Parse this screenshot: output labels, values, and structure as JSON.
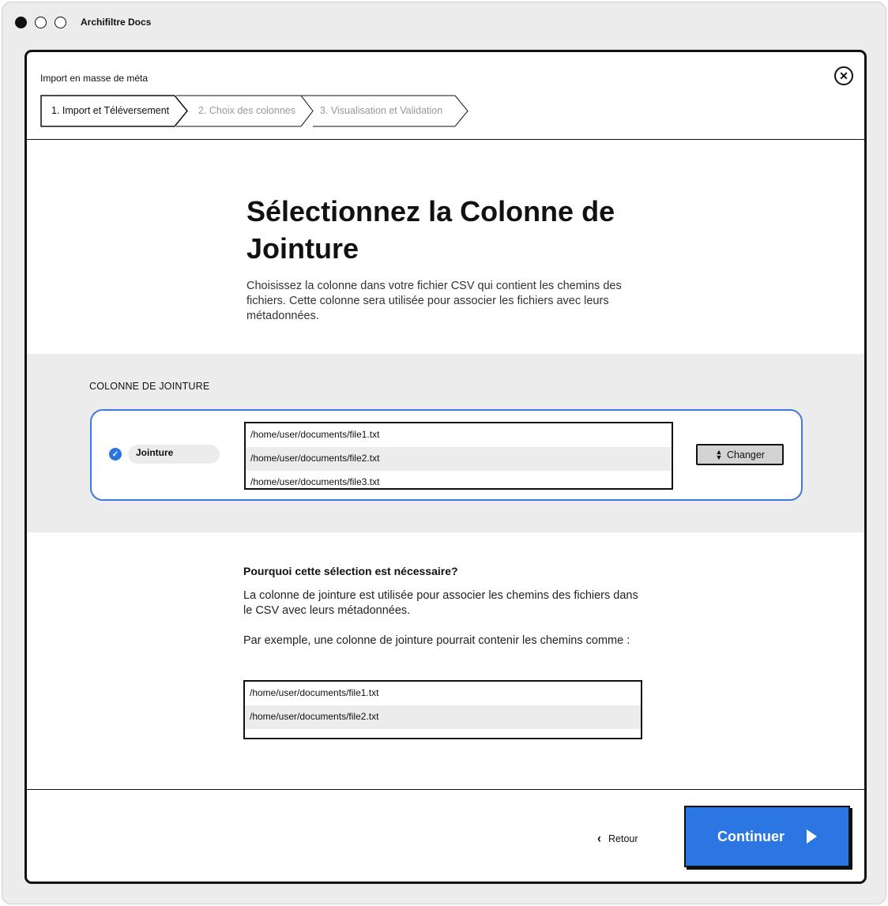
{
  "window": {
    "app_title": "Archifiltre Docs"
  },
  "modal": {
    "title": "Import en masse de méta",
    "steps": [
      {
        "label": "1. Import et Téléversement",
        "state": "active"
      },
      {
        "label": "2. Choix des colonnes",
        "state": "inactive"
      },
      {
        "label": "3. Visualisation et Validation",
        "state": "inactive"
      }
    ],
    "close_icon": "close-icon"
  },
  "main": {
    "heading": "Sélectionnez la Colonne de Jointure",
    "lead": "Choisissez la colonne dans votre fichier CSV qui contient les chemins des fichiers. Cette colonne sera utilisée pour associer les fichiers avec leurs métadonnées."
  },
  "join_section": {
    "label": "COLONNE DE JOINTURE",
    "column_name": "Jointure",
    "preview_rows": [
      "/home/user/documents/file1.txt",
      "/home/user/documents/file2.txt",
      "/home/user/documents/file3.txt"
    ],
    "change_label": "Changer"
  },
  "explanation": {
    "title": "Pourquoi cette sélection est nécessaire?",
    "paragraph1": "La colonne de jointure est utilisée pour associer les chemins des fichiers dans le CSV avec leurs métadonnées.",
    "paragraph2": "Par exemple, une colonne de jointure pourrait contenir les chemins comme :",
    "example_rows": [
      "/home/user/documents/file1.txt",
      "/home/user/documents/file2.txt"
    ]
  },
  "footer": {
    "back_label": "Retour",
    "continue_label": "Continuer"
  },
  "colors": {
    "accent": "#2c76e3",
    "card_border": "#3b7be0",
    "band": "#ececec"
  }
}
